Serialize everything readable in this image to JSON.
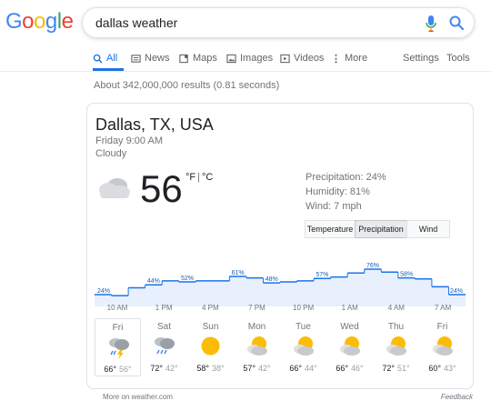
{
  "logo": {
    "letters": [
      "G",
      "o",
      "o",
      "g",
      "l",
      "e"
    ],
    "colors": [
      "#4285f4",
      "#ea4335",
      "#fbbc05",
      "#4285f4",
      "#34a853",
      "#ea4335"
    ]
  },
  "search": {
    "value": "dallas weather"
  },
  "tabs": [
    {
      "label": "All",
      "icon": "search-icon",
      "active": true
    },
    {
      "label": "News",
      "icon": "news-icon"
    },
    {
      "label": "Maps",
      "icon": "map-icon"
    },
    {
      "label": "Images",
      "icon": "image-icon"
    },
    {
      "label": "Videos",
      "icon": "play-icon"
    },
    {
      "label": "More",
      "icon": "more-icon"
    },
    {
      "label": "Settings"
    },
    {
      "label": "Tools"
    }
  ],
  "result_stats": "About 342,000,000 results (0.81 seconds)",
  "weather": {
    "location": "Dallas, TX, USA",
    "time": "Friday 9:00 AM",
    "condition": "Cloudy",
    "temp": "56",
    "unit_f": "°F",
    "unit_sep": "|",
    "unit_c": "°C",
    "precipitation": "Precipitation: 24%",
    "humidity": "Humidity: 81%",
    "wind": "Wind: 7 mph",
    "toggle": [
      "Temperature",
      "Precipitation",
      "Wind"
    ],
    "toggle_active": "Precipitation",
    "chart_data": {
      "type": "area",
      "step": true,
      "values": [
        24,
        22,
        38,
        44,
        52,
        50,
        52,
        52,
        61,
        58,
        48,
        50,
        52,
        57,
        60,
        68,
        76,
        70,
        58,
        56,
        40,
        24
      ],
      "labels": [
        {
          "index": 0,
          "text": "24%"
        },
        {
          "index": 3,
          "text": "44%"
        },
        {
          "index": 5,
          "text": "52%"
        },
        {
          "index": 8,
          "text": "61%"
        },
        {
          "index": 10,
          "text": "48%"
        },
        {
          "index": 13,
          "text": "57%"
        },
        {
          "index": 16,
          "text": "76%"
        },
        {
          "index": 18,
          "text": "58%"
        },
        {
          "index": 21,
          "text": "24%"
        }
      ],
      "ylim": [
        0,
        100
      ],
      "times": [
        "10 AM",
        "1 PM",
        "4 PM",
        "7 PM",
        "10 PM",
        "1 AM",
        "4 AM",
        "7 AM"
      ],
      "color": "#1a73e8",
      "fill": "#e8f0fe"
    },
    "days": [
      {
        "name": "Fri",
        "icon": "storm",
        "hi": "66°",
        "lo": "56°",
        "selected": true
      },
      {
        "name": "Sat",
        "icon": "rain",
        "hi": "72°",
        "lo": "42°"
      },
      {
        "name": "Sun",
        "icon": "sun",
        "hi": "58°",
        "lo": "38°"
      },
      {
        "name": "Mon",
        "icon": "partly",
        "hi": "57°",
        "lo": "42°"
      },
      {
        "name": "Tue",
        "icon": "partly",
        "hi": "66°",
        "lo": "44°"
      },
      {
        "name": "Wed",
        "icon": "partly",
        "hi": "66°",
        "lo": "46°"
      },
      {
        "name": "Thu",
        "icon": "partly",
        "hi": "72°",
        "lo": "51°"
      },
      {
        "name": "Fri",
        "icon": "partly",
        "hi": "60°",
        "lo": "43°"
      }
    ]
  },
  "footer": {
    "source": "More on weather.com",
    "feedback": "Feedback"
  }
}
